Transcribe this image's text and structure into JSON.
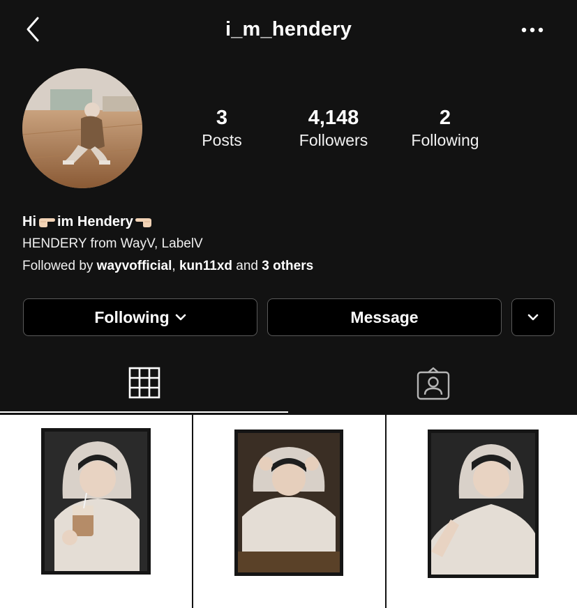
{
  "header": {
    "username": "i_m_hendery"
  },
  "profile": {
    "stats": [
      {
        "count": "3",
        "label": "Posts"
      },
      {
        "count": "4,148",
        "label": "Followers"
      },
      {
        "count": "2",
        "label": "Following"
      }
    ],
    "bio": {
      "name_part1": "Hi",
      "name_part2": "im Hendery",
      "line": "HENDERY from WayV, LabelV",
      "followed_prefix": "Followed by ",
      "followed_user1": "wayvofficial",
      "followed_sep": ", ",
      "followed_user2": "kun11xd",
      "followed_and": " and ",
      "followed_others": "3 others"
    }
  },
  "actions": {
    "following_label": "Following",
    "message_label": "Message"
  },
  "tabs": [
    {
      "icon": "grid-icon",
      "active": true
    },
    {
      "icon": "tagged-icon",
      "active": false
    }
  ],
  "posts": [
    {
      "description": "polaroid-drinking-coffee"
    },
    {
      "description": "polaroid-hands-on-hood"
    },
    {
      "description": "polaroid-selfie-smile"
    }
  ],
  "colors": {
    "background": "#121212",
    "button_background": "#000000",
    "button_border": "#5a5a5a",
    "text": "#ffffff"
  }
}
